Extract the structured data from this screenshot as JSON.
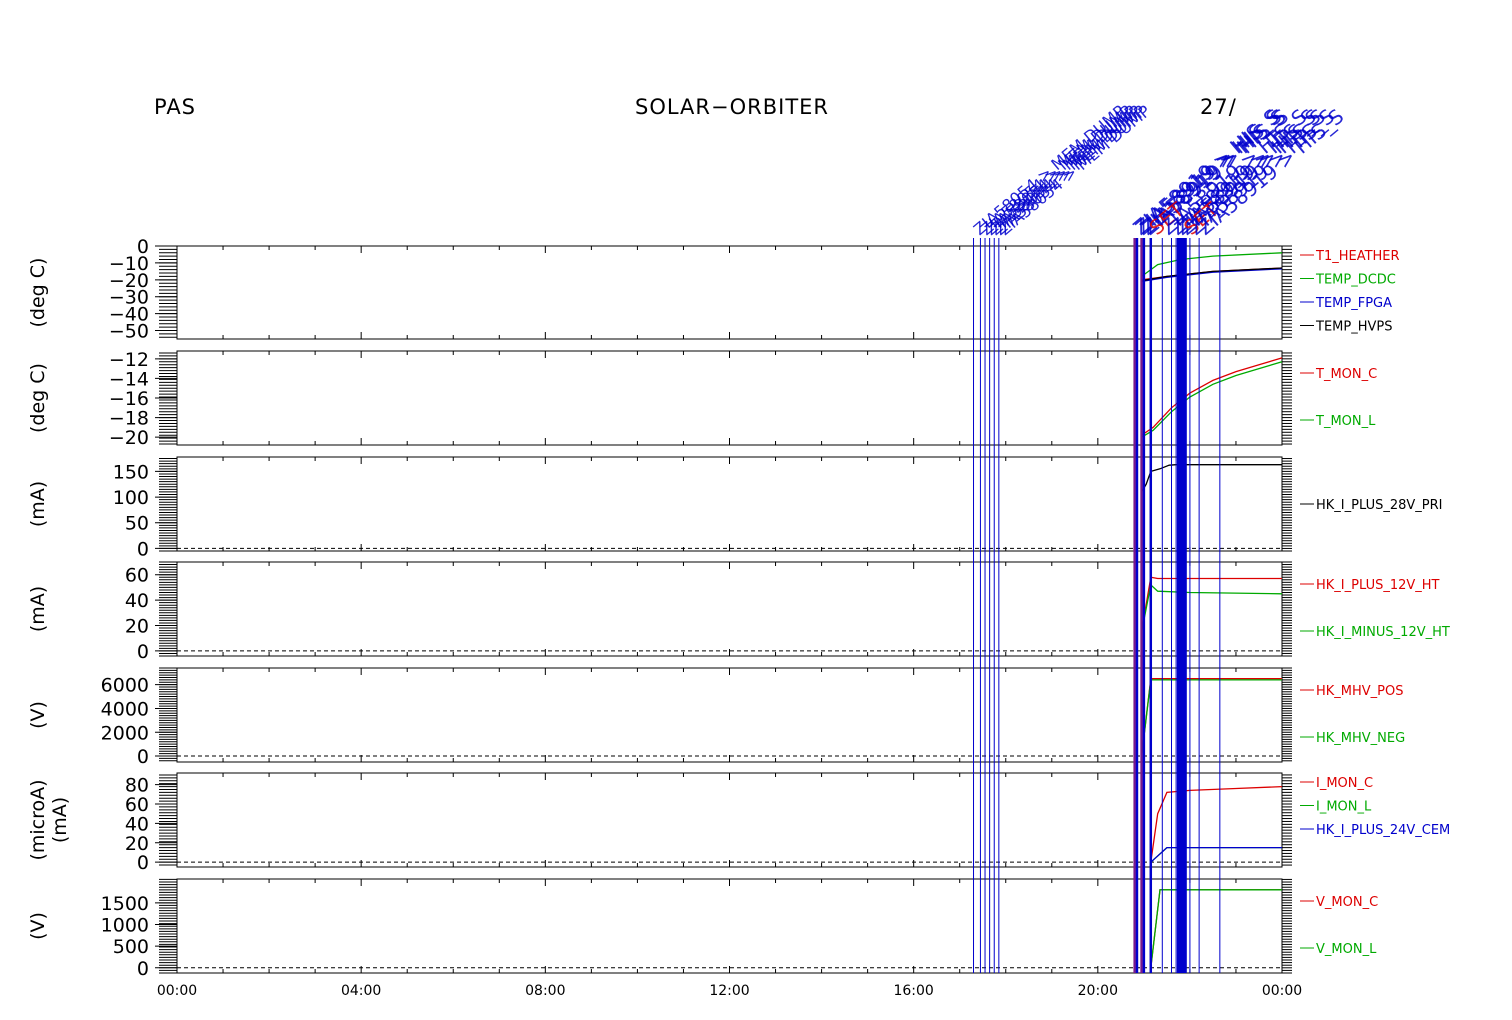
{
  "header": {
    "instrument": "PAS",
    "mission": "SOLAR−ORBITER",
    "date": "27/"
  },
  "colors": {
    "red": "#dd0000",
    "green": "#00aa00",
    "blue": "#0000cc",
    "black": "#000000",
    "purple": "#7a1a8a"
  },
  "event_labels": [
    {
      "text": "ZIA58054 > MEM DUMP",
      "color": "blue"
    },
    {
      "text": "ZIA58919 > HIS_S",
      "color": "blue"
    },
    {
      "text": "SET",
      "color": "red"
    }
  ],
  "chart_data": {
    "type": "line",
    "x_axis": {
      "range": [
        "00:00",
        "24:00"
      ],
      "tick_labels": [
        "00:00",
        "04:00",
        "08:00",
        "12:00",
        "16:00",
        "20:00",
        "00:00"
      ]
    },
    "event_lines": [
      {
        "t": 17.3,
        "color": "blue"
      },
      {
        "t": 17.45,
        "color": "blue"
      },
      {
        "t": 17.55,
        "color": "blue"
      },
      {
        "t": 17.65,
        "color": "blue"
      },
      {
        "t": 17.75,
        "color": "blue"
      },
      {
        "t": 17.85,
        "color": "blue"
      },
      {
        "t": 20.8,
        "color": "purple"
      },
      {
        "t": 20.85,
        "color": "blue"
      },
      {
        "t": 20.95,
        "color": "purple"
      },
      {
        "t": 21.0,
        "color": "blue"
      },
      {
        "t": 21.15,
        "color": "blue"
      },
      {
        "t": 21.4,
        "color": "blue"
      },
      {
        "t": 21.6,
        "color": "blue"
      },
      {
        "t": 21.7,
        "color": "blue"
      },
      {
        "t": 21.75,
        "color": "blue"
      },
      {
        "t": 21.8,
        "color": "blue"
      },
      {
        "t": 21.85,
        "color": "blue"
      },
      {
        "t": 21.9,
        "color": "blue"
      },
      {
        "t": 22.0,
        "color": "blue"
      },
      {
        "t": 22.2,
        "color": "blue"
      },
      {
        "t": 22.65,
        "color": "blue"
      }
    ],
    "panels": [
      {
        "ylabel": "(deg C)",
        "ylim": [
          -55,
          0
        ],
        "zero_line": true,
        "tick_labels": [
          {
            "v": 0,
            "t": "0"
          },
          {
            "v": -10,
            "t": "−10"
          },
          {
            "v": -20,
            "t": "−20"
          },
          {
            "v": -30,
            "t": "−30"
          },
          {
            "v": -40,
            "t": "−40"
          },
          {
            "v": -50,
            "t": "−50"
          }
        ],
        "series": [
          {
            "name": "T1_HEATHER",
            "color": "red",
            "x": [
              20.95,
              21.5,
              22.5,
              24
            ],
            "y": [
              -20,
              -18,
              -15,
              -13
            ]
          },
          {
            "name": "TEMP_DCDC",
            "color": "green",
            "x": [
              20.95,
              21.3,
              21.8,
              22.5,
              24
            ],
            "y": [
              -18,
              -11,
              -8,
              -6,
              -4
            ]
          },
          {
            "name": "TEMP_FPGA",
            "color": "blue",
            "x": [
              20.95,
              21.5,
              22.5,
              24
            ],
            "y": [
              -21,
              -18.5,
              -15.5,
              -13.5
            ]
          },
          {
            "name": "TEMP_HVPS",
            "color": "black",
            "x": [
              20.95,
              21.5,
              22.5,
              24
            ],
            "y": [
              -20.5,
              -18,
              -15,
              -13
            ]
          }
        ]
      },
      {
        "ylabel": "(deg C)",
        "ylim": [
          -20.8,
          -11.2
        ],
        "zero_line": false,
        "tick_labels": [
          {
            "v": -12,
            "t": "−12"
          },
          {
            "v": -14,
            "t": "−14"
          },
          {
            "v": -16,
            "t": "−16"
          },
          {
            "v": -18,
            "t": "−18"
          },
          {
            "v": -20,
            "t": "−20"
          }
        ],
        "series": [
          {
            "name": "T_MON_C",
            "color": "red",
            "x": [
              20.95,
              21.2,
              21.6,
              22.0,
              22.5,
              23.0,
              23.5,
              24
            ],
            "y": [
              -19.8,
              -19.0,
              -17.0,
              -15.5,
              -14.2,
              -13.3,
              -12.6,
              -11.9
            ]
          },
          {
            "name": "T_MON_L",
            "color": "green",
            "x": [
              20.95,
              21.2,
              21.6,
              22.0,
              22.5,
              23.0,
              23.5,
              24
            ],
            "y": [
              -20.0,
              -19.3,
              -17.4,
              -15.9,
              -14.6,
              -13.7,
              -13.0,
              -12.3
            ]
          }
        ]
      },
      {
        "ylabel": "(mA)",
        "ylim": [
          -5,
          178
        ],
        "zero_line": true,
        "tick_labels": [
          {
            "v": 150,
            "t": "150"
          },
          {
            "v": 100,
            "t": "100"
          },
          {
            "v": 50,
            "t": "50"
          },
          {
            "v": 0,
            "t": "0"
          }
        ],
        "series": [
          {
            "name": "HK_I_PLUS_28V_PRI",
            "color": "black",
            "x": [
              20.95,
              21.05,
              21.15,
              21.35,
              21.55,
              21.7,
              24
            ],
            "y": [
              110,
              125,
              150,
              155,
              162,
              163,
              163
            ]
          }
        ]
      },
      {
        "ylabel": "(mA)",
        "ylim": [
          -4,
          70
        ],
        "zero_line": true,
        "tick_labels": [
          {
            "v": 60,
            "t": "60"
          },
          {
            "v": 40,
            "t": "40"
          },
          {
            "v": 20,
            "t": "20"
          },
          {
            "v": 0,
            "t": "0"
          }
        ],
        "series": [
          {
            "name": "HK_I_PLUS_12V_HT",
            "color": "red",
            "x": [
              20.95,
              21.15,
              21.3,
              24
            ],
            "y": [
              15,
              58,
              57,
              57
            ]
          },
          {
            "name": "HK_I_MINUS_12V_HT",
            "color": "green",
            "x": [
              20.95,
              21.15,
              21.3,
              22,
              24
            ],
            "y": [
              15,
              52,
              47,
              46,
              45
            ]
          }
        ]
      },
      {
        "ylabel": "(V)",
        "ylim": [
          -500,
          7400
        ],
        "zero_line": true,
        "tick_labels": [
          {
            "v": 6000,
            "t": "6000"
          },
          {
            "v": 4000,
            "t": "4000"
          },
          {
            "v": 2000,
            "t": "2000"
          },
          {
            "v": 0,
            "t": "0"
          }
        ],
        "series": [
          {
            "name": "HK_MHV_POS",
            "color": "red",
            "x": [
              20.95,
              21.15,
              24
            ],
            "y": [
              0,
              6500,
              6500
            ]
          },
          {
            "name": "HK_MHV_NEG",
            "color": "green",
            "x": [
              20.95,
              21.15,
              24
            ],
            "y": [
              0,
              6400,
              6400
            ]
          }
        ]
      },
      {
        "ylabel": "(microA)",
        "ylabel2": "(mA)",
        "ylim": [
          -5,
          92
        ],
        "zero_line": true,
        "tick_labels": [
          {
            "v": 80,
            "t": "80"
          },
          {
            "v": 60,
            "t": "60"
          },
          {
            "v": 40,
            "t": "40"
          },
          {
            "v": 20,
            "t": "20"
          },
          {
            "v": 0,
            "t": "0"
          }
        ],
        "series": [
          {
            "name": "I_MON_C",
            "color": "red",
            "x": [
              21.15,
              21.3,
              21.5,
              22,
              23,
              24
            ],
            "y": [
              0,
              50,
              72,
              74,
              76,
              78
            ]
          },
          {
            "name": "I_MON_L",
            "color": "green",
            "x": [
              21.15,
              21.5,
              24
            ],
            "y": [
              0,
              15,
              15
            ]
          },
          {
            "name": "HK_I_PLUS_24V_CEM",
            "color": "blue",
            "x": [
              21.15,
              21.5,
              24
            ],
            "y": [
              0,
              15,
              15
            ]
          }
        ]
      },
      {
        "ylabel": "(V)",
        "ylim": [
          -120,
          2050
        ],
        "zero_line": true,
        "tick_labels": [
          {
            "v": 1500,
            "t": "1500"
          },
          {
            "v": 1000,
            "t": "1000"
          },
          {
            "v": 500,
            "t": "500"
          },
          {
            "v": 0,
            "t": "0"
          }
        ],
        "series": [
          {
            "name": "V_MON_C",
            "color": "red",
            "x": [
              21.15,
              21.35,
              24
            ],
            "y": [
              0,
              1800,
              1800
            ]
          },
          {
            "name": "V_MON_L",
            "color": "green",
            "x": [
              21.15,
              21.35,
              24
            ],
            "y": [
              0,
              1800,
              1800
            ]
          }
        ]
      }
    ]
  }
}
